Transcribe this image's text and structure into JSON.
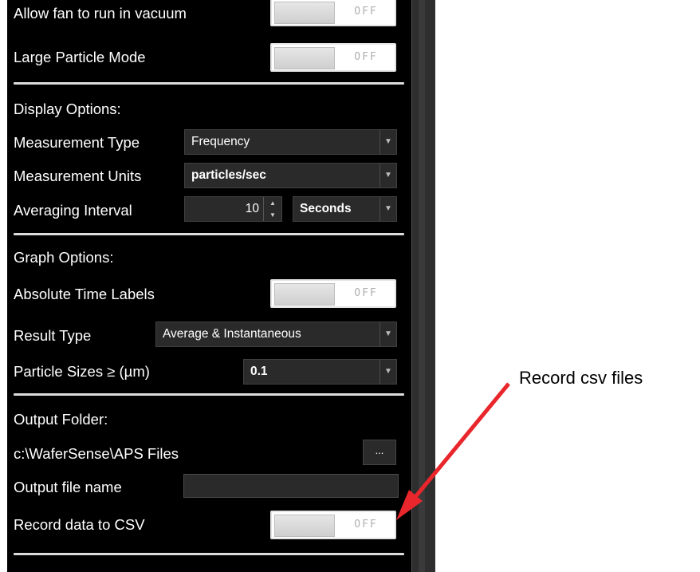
{
  "settings": {
    "fan_vacuum": {
      "label": "Allow fan to run in vacuum",
      "state": "OFF"
    },
    "large_particle": {
      "label": "Large Particle Mode",
      "state": "OFF"
    }
  },
  "display_options": {
    "heading": "Display Options:",
    "measurement_type": {
      "label": "Measurement Type",
      "value": "Frequency"
    },
    "measurement_units": {
      "label": "Measurement Units",
      "value": "particles/sec"
    },
    "averaging_interval": {
      "label": "Averaging Interval",
      "value": "10",
      "unit": "Seconds"
    }
  },
  "graph_options": {
    "heading": "Graph Options:",
    "absolute_time": {
      "label": "Absolute Time Labels",
      "state": "OFF"
    },
    "result_type": {
      "label": "Result Type",
      "value": "Average & Instantaneous"
    },
    "particle_sizes": {
      "label": "Particle Sizes ≥ (µm)",
      "value": "0.1"
    }
  },
  "output": {
    "heading": "Output Folder:",
    "folder_path": "c:\\WaferSense\\APS Files",
    "browse_label": "...",
    "file_name_label": "Output file name",
    "file_name_value": "",
    "record_csv": {
      "label": "Record data to CSV",
      "state": "OFF"
    }
  },
  "annotation": {
    "text": "Record csv files",
    "arrow_color": "#e8262b"
  },
  "icons": {
    "dropdown": "dropdown-arrow-icon",
    "spin_up": "spin-up-icon",
    "spin_down": "spin-down-icon"
  }
}
